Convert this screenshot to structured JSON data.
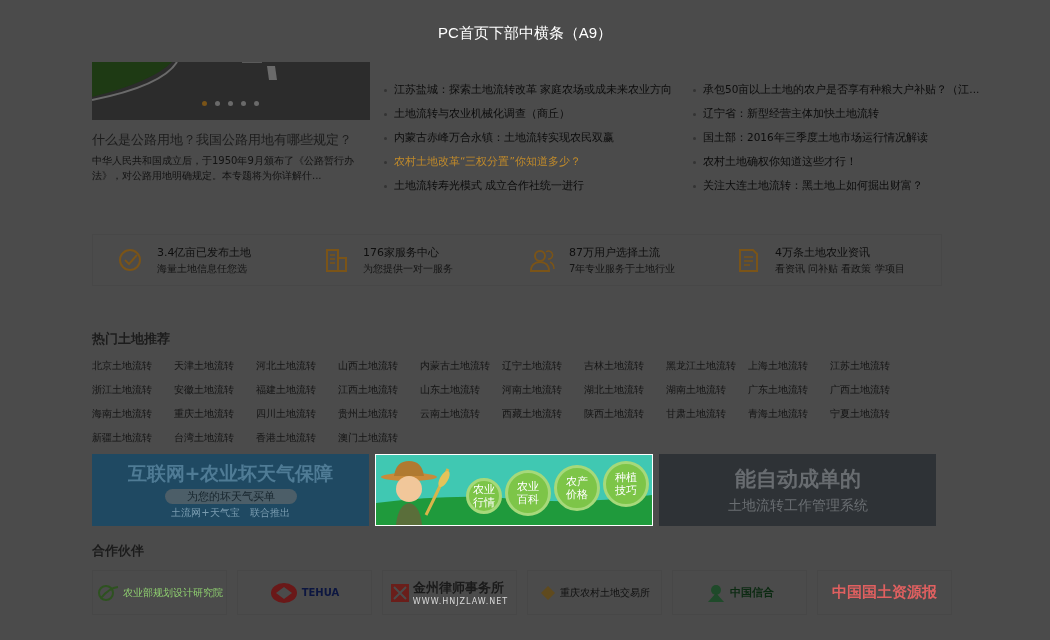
{
  "overlay_title": "PC首页下部中横条（A9）",
  "feature": {
    "dots": [
      {
        "selected": true
      },
      {
        "selected": false
      },
      {
        "selected": false
      },
      {
        "selected": false
      },
      {
        "selected": false
      }
    ],
    "title": "什么是公路用地？我国公路用地有哪些规定？",
    "summary": "中华人民共和国成立后，于1950年9月颁布了《公路暂行办法》，对公路用地明确规定。本专题将为你详解什..."
  },
  "news_columns": [
    [
      {
        "text": "江苏盐城：探索土地流转改革 家庭农场或成未来农业方向",
        "highlighted": false
      },
      {
        "text": "土地流转与农业机械化调查（商丘）",
        "highlighted": false
      },
      {
        "text": "内蒙古赤峰万合永镇：土地流转实现农民双赢",
        "highlighted": false
      },
      {
        "text": "农村土地改革“三权分置”你知道多少？",
        "highlighted": true
      },
      {
        "text": "土地流转寿光模式 成立合作社统一进行",
        "highlighted": false
      }
    ],
    [
      {
        "text": "承包50亩以上土地的农户是否享有种粮大户补贴？（江...",
        "highlighted": false
      },
      {
        "text": "辽宁省：新型经营主体加快土地流转",
        "highlighted": false
      },
      {
        "text": "国土部：2016年三季度土地市场运行情况解读",
        "highlighted": false
      },
      {
        "text": "农村土地确权你知道这些才行！",
        "highlighted": false
      },
      {
        "text": "关注大连土地流转：黑土地上如何掘出财富？",
        "highlighted": false
      }
    ]
  ],
  "stats": [
    {
      "kind": "check",
      "title": "3.4亿亩已发布土地",
      "subtitle": "海量土地信息任您选"
    },
    {
      "kind": "building",
      "title": "176家服务中心",
      "subtitle": "为您提供一对一服务"
    },
    {
      "kind": "users",
      "title": "87万用户选择土流",
      "subtitle": "7年专业服务于土地行业"
    },
    {
      "kind": "document",
      "title": "4万条土地农业资讯",
      "subtitle": "看资讯 问补贴 看政策 学项目"
    }
  ],
  "hot_land": {
    "title": "热门土地推荐",
    "links": [
      "北京土地流转",
      "天津土地流转",
      "河北土地流转",
      "山西土地流转",
      "内蒙古土地流转",
      "辽宁土地流转",
      "吉林土地流转",
      "黑龙江土地流转",
      "上海土地流转",
      "江苏土地流转",
      "浙江土地流转",
      "安徽土地流转",
      "福建土地流转",
      "江西土地流转",
      "山东土地流转",
      "河南土地流转",
      "湖北土地流转",
      "湖南土地流转",
      "广东土地流转",
      "广西土地流转",
      "海南土地流转",
      "重庆土地流转",
      "四川土地流转",
      "贵州土地流转",
      "云南土地流转",
      "西藏土地流转",
      "陕西土地流转",
      "甘肃土地流转",
      "青海土地流转",
      "宁夏土地流转",
      "新疆土地流转",
      "台湾土地流转",
      "香港土地流转",
      "澳门土地流转"
    ]
  },
  "banners": [
    {
      "kind": "insurance",
      "selected": false,
      "lines": [
        "互联网+农业坏天气保障",
        "为您的坏天气买单",
        "土流网+天气宝　联合推出"
      ]
    },
    {
      "kind": "farmer",
      "selected": true,
      "lines": [
        "农业行情",
        "农业百科",
        "农产价格",
        "种植技巧"
      ]
    },
    {
      "kind": "system",
      "selected": false,
      "lines": [
        "能自动成单的",
        "土地流转工作管理系统"
      ]
    }
  ],
  "partners": {
    "title": "合作伙伴",
    "logos": [
      {
        "kind": "green",
        "name": "农业部规划设计研究院"
      },
      {
        "kind": "red",
        "name": "TEHUA"
      },
      {
        "kind": "law",
        "name": "金州律师事务所",
        "sub": "WWW.HNJZLAW.NET"
      },
      {
        "kind": "gold",
        "name": "重庆农村土地交易所"
      },
      {
        "kind": "bank",
        "name": "中国信合"
      },
      {
        "kind": "paper",
        "name": "中国国土资源报"
      }
    ]
  }
}
